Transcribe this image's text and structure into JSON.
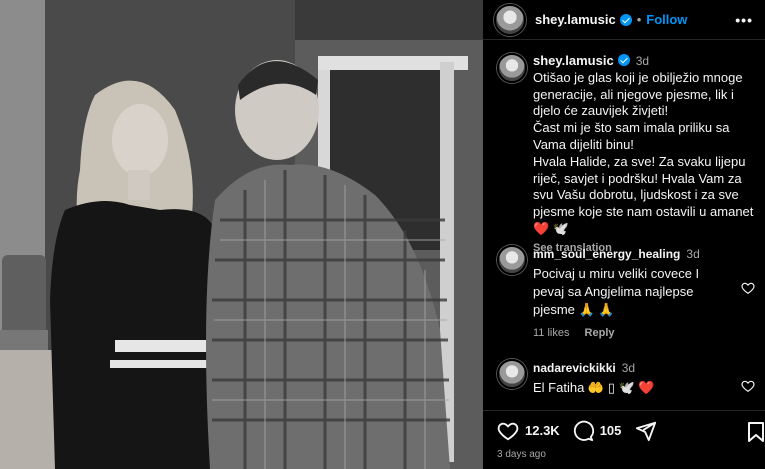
{
  "post_author": {
    "username": "shey.lamusic",
    "follow_label": "Follow",
    "more_icon": "more-options-icon"
  },
  "caption": {
    "username": "shey.lamusic",
    "time": "3d",
    "text": "Otišao je glas koji je obilježio mnoge generacije, ali njegove pjesme, lik i djelo će zauvijek živjeti!\nČast mi je što sam imala priliku sa Vama dijeliti binu!\nHvala Halide, za sve! Za svaku lijepu riječ, savjet i podršku! Hvala Vam za svu Vašu dobrotu, ljudskost i za sve pjesme koje ste nam ostavili u amanet ❤️ 🕊️",
    "see_translation": "See translation"
  },
  "comments": [
    {
      "username": "mm_soul_energy_healing",
      "time": "3d",
      "text": "Pocivaj u miru veliki covece I pevaj sa Angjelima najlepse pjesme 🙏 🙏",
      "likes": "11 likes",
      "reply_label": "Reply"
    },
    {
      "username": "nadarevickikki",
      "time": "3d",
      "text": "El Fatiha 🤲 ▯ 🕊️ ❤️"
    }
  ],
  "actions": {
    "likes_count": "12.3K",
    "comments_count": "105",
    "posted": "3 days ago"
  },
  "colors": {
    "accent": "#0095f6",
    "heart": "#ed4956",
    "muted": "#a8a8a8",
    "divider": "#262626"
  }
}
